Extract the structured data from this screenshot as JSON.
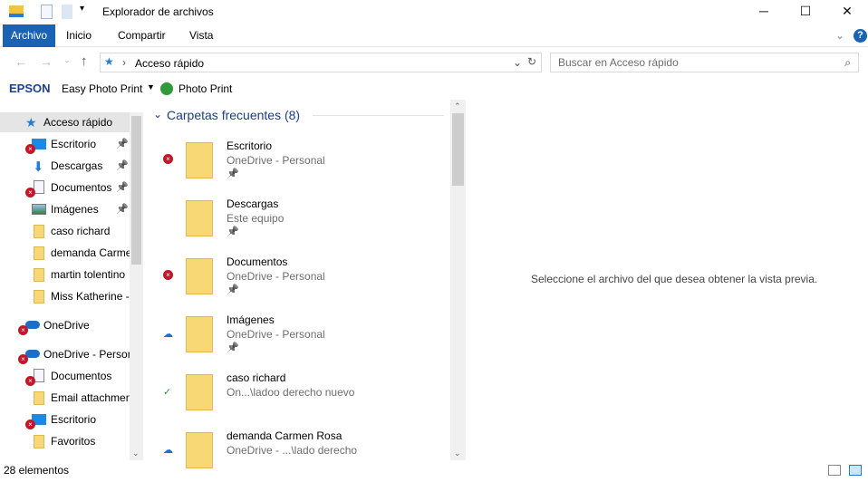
{
  "window": {
    "title": "Explorador de archivos",
    "minimize": "─",
    "maximize": "☐",
    "close": "✕"
  },
  "ribbon": {
    "tabs": [
      "Archivo",
      "Inicio",
      "Compartir",
      "Vista"
    ],
    "help": "?"
  },
  "address": {
    "path": "Acceso rápido",
    "search_placeholder": "Buscar en Acceso rápido"
  },
  "toolbar": {
    "brand": "EPSON",
    "easy_photo": "Easy Photo Print",
    "photo_print": "Photo Print",
    "brand_color": "#1c3f94"
  },
  "nav": {
    "items": [
      {
        "label": "Acceso rápido",
        "top": true,
        "icon": "star-icon"
      },
      {
        "label": "Escritorio",
        "pin": true,
        "err": true,
        "icon": "desktop-icon"
      },
      {
        "label": "Descargas",
        "pin": true,
        "icon": "download-icon"
      },
      {
        "label": "Documentos",
        "pin": true,
        "err": true,
        "icon": "document-icon"
      },
      {
        "label": "Imágenes",
        "pin": true,
        "icon": "image-icon"
      },
      {
        "label": "caso richard",
        "icon": "folder-icon"
      },
      {
        "label": "demanda Carmen Rosa",
        "icon": "folder-icon"
      },
      {
        "label": "martin tolentino",
        "icon": "folder-icon"
      },
      {
        "label": "Miss Katherine - ",
        "icon": "folder-icon"
      },
      {
        "label": "OneDrive",
        "top": true,
        "err": true,
        "icon": "cloud-icon",
        "gap": true
      },
      {
        "label": "OneDrive - Personal",
        "top": true,
        "err": true,
        "icon": "cloud-icon",
        "gap": true
      },
      {
        "label": "Documentos",
        "err": true,
        "icon": "document-icon"
      },
      {
        "label": "Email attachments",
        "icon": "folder-icon"
      },
      {
        "label": "Escritorio",
        "err": true,
        "icon": "desktop-icon"
      },
      {
        "label": "Favoritos",
        "icon": "folder-icon"
      }
    ]
  },
  "content": {
    "group": "Carpetas frecuentes (8)",
    "items": [
      {
        "name": "Escritorio",
        "sub": "OneDrive - Personal",
        "pin": true,
        "status": "error"
      },
      {
        "name": "Descargas",
        "sub": "Este equipo",
        "pin": true,
        "status": "none"
      },
      {
        "name": "Documentos",
        "sub": "OneDrive - Personal",
        "pin": true,
        "status": "error"
      },
      {
        "name": "Imágenes",
        "sub": "OneDrive - Personal",
        "pin": true,
        "status": "cloud"
      },
      {
        "name": "caso richard",
        "sub": "On...\\ladoo derecho nuevo",
        "pin": false,
        "status": "synced"
      },
      {
        "name": "demanda Carmen Rosa",
        "sub": "OneDrive - ...\\lado derecho",
        "pin": false,
        "status": "cloud"
      }
    ]
  },
  "preview": {
    "message": "Seleccione el archivo del que desea obtener la vista previa."
  },
  "status": {
    "count": "28 elementos"
  }
}
